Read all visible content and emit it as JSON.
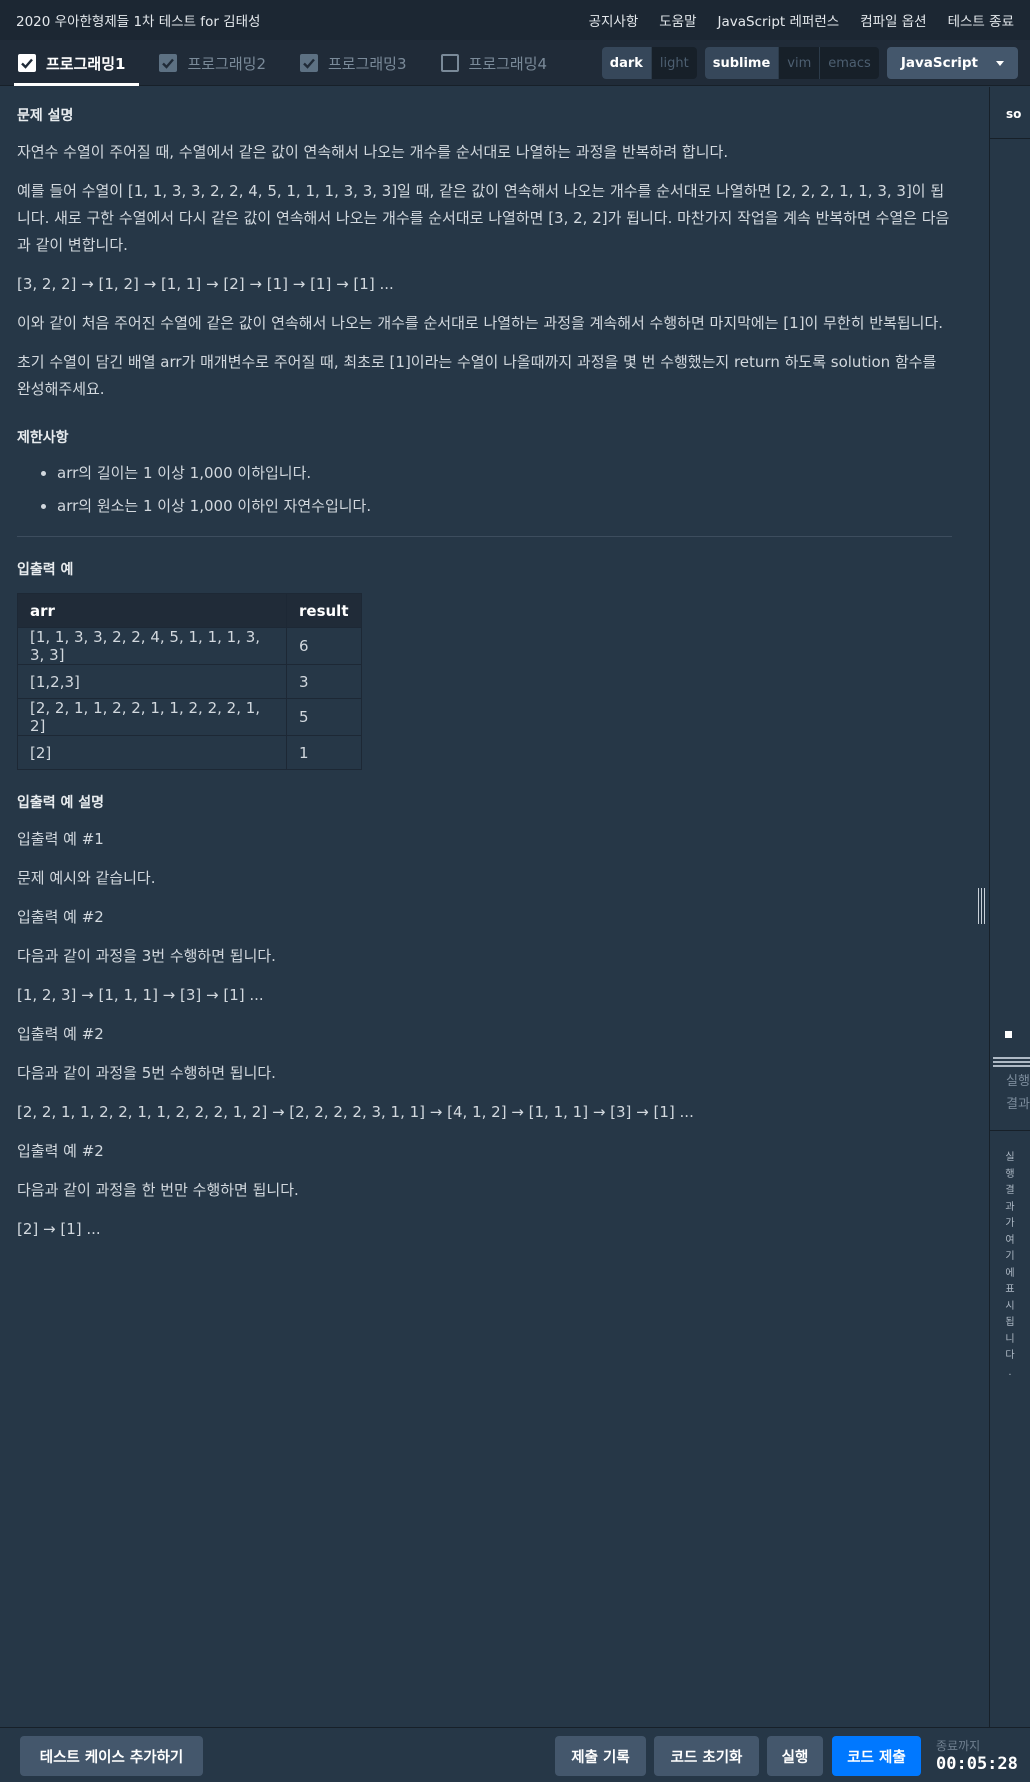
{
  "topnav": {
    "title": "2020 우아한형제들 1차 테스트 for 김태성",
    "links": [
      "공지사항",
      "도움말",
      "JavaScript 레퍼런스",
      "컴파일 옵션",
      "테스트 종료"
    ]
  },
  "tabs": [
    {
      "label": "프로그래밍1",
      "checked": true,
      "active": true
    },
    {
      "label": "프로그래밍2",
      "checked": true,
      "active": false
    },
    {
      "label": "프로그래밍3",
      "checked": true,
      "active": false
    },
    {
      "label": "프로그래밍4",
      "checked": false,
      "active": false
    }
  ],
  "theme": {
    "options": [
      "dark",
      "light"
    ],
    "selected": "dark"
  },
  "keymap": {
    "options": [
      "sublime",
      "vim",
      "emacs"
    ],
    "selected": "sublime"
  },
  "language": "JavaScript",
  "problem": {
    "heading": "문제 설명",
    "paragraphs": [
      "자연수 수열이 주어질 때, 수열에서 같은 값이 연속해서 나오는 개수를 순서대로 나열하는 과정을 반복하려 합니다.",
      "예를 들어 수열이 [1, 1, 3, 3, 2, 2, 4, 5, 1, 1, 1, 3, 3, 3]일 때, 같은 값이 연속해서 나오는 개수를 순서대로 나열하면 [2, 2, 2, 1, 1, 3, 3]이 됩니다. 새로 구한 수열에서 다시 같은 값이 연속해서 나오는 개수를 순서대로 나열하면 [3, 2, 2]가 됩니다. 마찬가지 작업을 계속 반복하면 수열은 다음과 같이 변합니다.",
      "[3, 2, 2] → [1, 2] → [1, 1] → [2] → [1] → [1] → [1] ...",
      "이와 같이 처음 주어진 수열에 같은 값이 연속해서 나오는 개수를 순서대로 나열하는 과정을 계속해서 수행하면 마지막에는 [1]이 무한히 반복됩니다.",
      "초기 수열이 담긴 배열 arr가 매개변수로 주어질 때, 최초로 [1]이라는 수열이 나올때까지 과정을 몇 번 수행했는지 return 하도록 solution 함수를 완성해주세요."
    ]
  },
  "constraints": {
    "heading": "제한사항",
    "items": [
      "arr의 길이는 1 이상 1,000 이하입니다.",
      "arr의 원소는 1 이상 1,000 이하인 자연수입니다."
    ]
  },
  "examples": {
    "heading": "입출력 예",
    "headers": [
      "arr",
      "result"
    ],
    "rows": [
      [
        "[1, 1, 3, 3, 2, 2, 4, 5, 1, 1, 1, 3, 3, 3]",
        "6"
      ],
      [
        "[1,2,3]",
        "3"
      ],
      [
        "[2, 2, 1, 1, 2, 2, 1, 1, 2, 2, 2, 1, 2]",
        "5"
      ],
      [
        "[2]",
        "1"
      ]
    ]
  },
  "explanation": {
    "heading": "입출력 예 설명",
    "paragraphs": [
      "입출력 예 #1",
      "문제 예시와 같습니다.",
      "입출력 예 #2",
      "다음과 같이 과정을 3번 수행하면 됩니다.",
      "[1, 2, 3] → [1, 1, 1] → [3] → [1] ...",
      "입출력 예 #2",
      "다음과 같이 과정을 5번 수행하면 됩니다.",
      "[2, 2, 1, 1, 2, 2, 1, 1, 2, 2, 2, 1, 2] → [2, 2, 2, 2, 3, 1, 1] → [4, 1, 2] → [1, 1, 1] → [3] → [1] ...",
      "입출력 예 #2",
      "다음과 같이 과정을 한 번만 수행하면 됩니다.",
      "[2] → [1] ..."
    ]
  },
  "right_panel": {
    "header": "so",
    "tabs": [
      "실행",
      "결과"
    ],
    "vertical_text": "실행결과가여기에표시됩니다."
  },
  "bottom": {
    "add_testcase": "테스트 케이스 추가하기",
    "submit_history": "제출 기록",
    "reset_code": "코드 초기화",
    "run": "실행",
    "submit": "코드 제출",
    "timer_label": "종료까지",
    "timer": "00:05:28"
  }
}
